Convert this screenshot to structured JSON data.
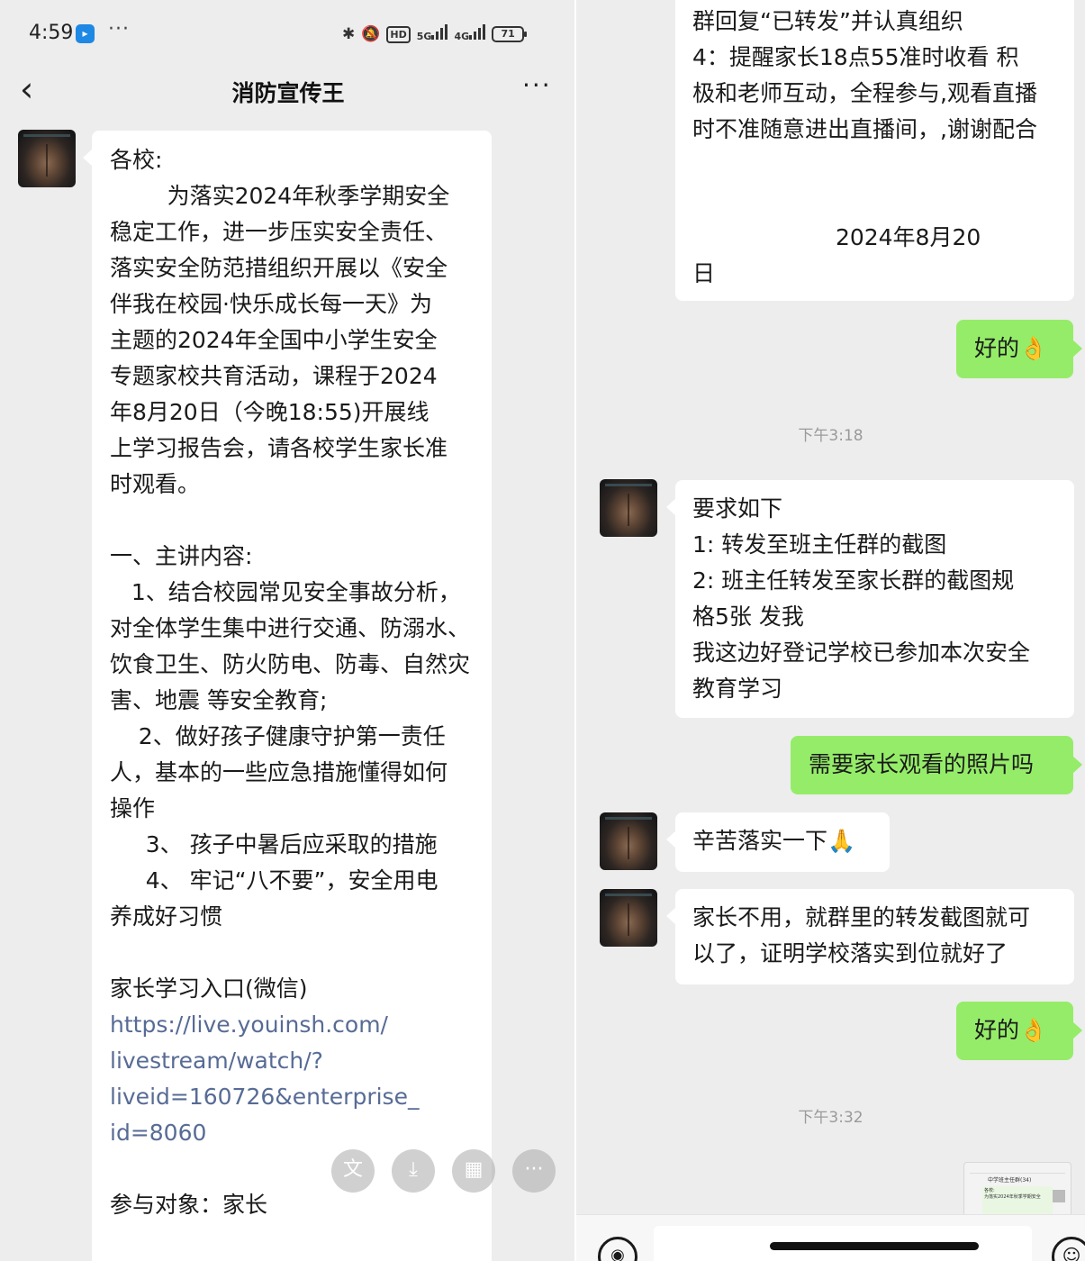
{
  "status_bar": {
    "time": "4:59",
    "notification_dots": "···",
    "icons": [
      "bluetooth-icon",
      "mute-icon",
      "hd-icon",
      "5g-signal-icon",
      "4g-signal-icon",
      "battery-icon"
    ],
    "hd_label": "HD",
    "net_5g": "5G",
    "net_4g": "4G",
    "battery": "71"
  },
  "nav": {
    "back_icon": "‹",
    "title": "消防宣传王",
    "more_icon": "···"
  },
  "left_message": {
    "lines": [
      "各校:",
      "        为落实2024年秋季学期安全",
      "稳定工作，进一步压实安全责任、",
      "落实安全防范措组织开展以《安全",
      "伴我在校园·快乐成长每一天》为",
      "主题的2024年全国中小学生安全",
      "专题家校共育活动，课程于2024",
      "年8月20日（今晚18:55)开展线",
      "上学习报告会，请各校学生家长准",
      "时观看。",
      "",
      "一、主讲内容:",
      "   1、结合校园常见安全事故分析，",
      "对全体学生集中进行交通、防溺水、",
      "饮食卫生、防火防电、防毒、自然灾",
      "害、地震 等安全教育;",
      "    2、做好孩子健康守护第一责任",
      "人，基本的一些应急措施懂得如何",
      "操作",
      "     3、 孩子中暑后应采取的措施",
      "     4、 牢记“八不要”，安全用电",
      "养成好习惯",
      "",
      "家长学习入口(微信)"
    ],
    "link_lines": [
      "https://live.youinsh.com/",
      "livestream/watch/?",
      "liveid=160726&enterprise_",
      "id=8060"
    ],
    "after_link": [
      "",
      "参与对象：家长"
    ]
  },
  "floating_actions": {
    "translate": "文",
    "download": "⤓",
    "grid": "▦",
    "more": "···"
  },
  "right_top_message": {
    "lines": [
      "群回复“已转发”并认真组织",
      "4：提醒家长18点55准时收看 积",
      "极和老师互动，全程参与,观看直播",
      "时不准随意进出直播间，,谢谢配合",
      "",
      "",
      "                    2024年8月20",
      "日"
    ]
  },
  "chat": {
    "reply_ok_1": "好的👌",
    "timestamp_1": "下午3:18",
    "requirements": [
      "要求如下",
      "1: 转发至班主任群的截图",
      "2: 班主任转发至家长群的截图规",
      "格5张 发我",
      "我这边好登记学校已参加本次安全",
      "教育学习"
    ],
    "question": "需要家长观看的照片吗",
    "thanks": "辛苦落实一下🙏",
    "answer": [
      "家长不用，就群里的转发截图就可",
      "以了，证明学校落实到位就好了"
    ],
    "reply_ok_2": "好的👌",
    "timestamp_2": "下午3:32"
  },
  "thumbnail": {
    "header": "中学班主任群(34)",
    "preview_lines": [
      "各校:",
      "为落实2024年秋季学期安全"
    ]
  },
  "input_bar": {
    "voice_icon": "◉",
    "emoji_icon": "☺"
  }
}
